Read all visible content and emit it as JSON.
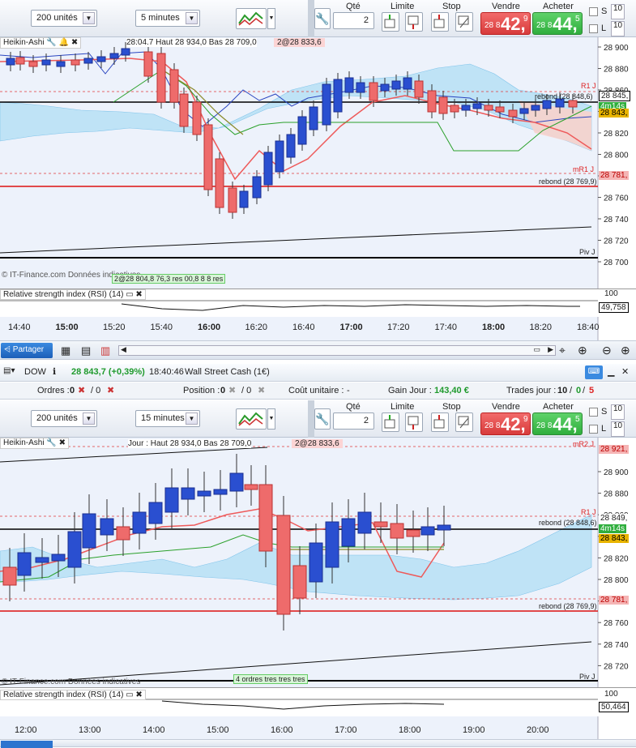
{
  "top": {
    "quantity": "200 unités",
    "interval": "5 minutes",
    "qte_label": "Qté",
    "qte_value": "2",
    "limite_label": "Limite",
    "stop_label": "Stop",
    "vendre_label": "Vendre",
    "acheter_label": "Acheter",
    "bid_small": "28 8",
    "bid_big": "42,",
    "bid_tiny": "9",
    "ask_small": "28 8",
    "ask_big": "44,",
    "ask_tiny": "5",
    "s_label": "S",
    "l_label": "L",
    "s_value": "10",
    "l_value": "10",
    "chart_title": "Heikin-Ashi",
    "legend": "28:04.7 Haut 28 934,0 Bas 28 709,0",
    "legend2": "2@28 833,6",
    "order_legend": "2@28 804,8 76,3 res 00,8 8 8 res",
    "copyright": "© IT-Finance.com  Données indicatives",
    "rsi_label": "Relative strength index (RSI) (14)",
    "rsi_value": "49,758",
    "rsi_top": "100",
    "price_ticks": [
      "28 900",
      "28 880",
      "28 860",
      "28 840",
      "28 820",
      "28 800",
      "28 780",
      "28 760",
      "28 740",
      "28 720",
      "28 700"
    ],
    "badges": {
      "r1": "R1 J",
      "last": "28 845,",
      "timer": "4m14s",
      "cur": "28 843,",
      "mr1": "mR1 J",
      "mr1v": "28 781,",
      "piv": "Piv J"
    },
    "rebond1": "rebond (28 848,6)",
    "rebond2": "rebond (28 769,9)",
    "time_ticks": [
      "14:40",
      "15:00",
      "15:20",
      "15:40",
      "16:00",
      "16:20",
      "16:40",
      "17:00",
      "17:20",
      "17:40",
      "18:00",
      "18:20",
      "18:40"
    ]
  },
  "mid": {
    "share": "Partager",
    "symbol": "DOW",
    "price": "28 843,7 (+0,39%)",
    "time": "18:40:46",
    "name": "Wall Street Cash (1€)",
    "orders_label": "Ordres :",
    "orders": "0",
    "orders2": "/ 0",
    "position_label": "Position :",
    "position": "0",
    "position2": "/ 0",
    "cout_label": "Coût unitaire :",
    "cout": "-",
    "gain_label": "Gain Jour :",
    "gain": "143,40 €",
    "trades_label": "Trades jour :",
    "trades_a": "10",
    "trades_b": "0",
    "trades_c": "5"
  },
  "bottom": {
    "quantity": "200 unités",
    "interval": "15 minutes",
    "qte_label": "Qté",
    "qte_value": "2",
    "limite_label": "Limite",
    "stop_label": "Stop",
    "vendre_label": "Vendre",
    "acheter_label": "Acheter",
    "bid_small": "28 8",
    "bid_big": "42,",
    "bid_tiny": "9",
    "ask_small": "28 8",
    "ask_big": "44,",
    "ask_tiny": "5",
    "s_label": "S",
    "l_label": "L",
    "s_value": "10",
    "l_value": "10",
    "chart_title": "Heikin-Ashi",
    "legend": "Jour : Haut 28 934,0 Bas 28 709,0",
    "legend2": "2@28 833,6",
    "order_legend": "4 ordres tres tres tres",
    "copyright": "© IT-Finance.com  Données indicatives",
    "rsi_label": "Relative strength index (RSI) (14)",
    "rsi_value": "50,464",
    "rsi_top": "100",
    "price_ticks": [
      "28 900",
      "28 880",
      "28 860",
      "28 840",
      "28 820",
      "28 800",
      "28 780",
      "28 760",
      "28 740",
      "28 720"
    ],
    "badges": {
      "mr2": "mR2 J",
      "mr2v": "28 921,",
      "r1": "R1 J",
      "last": "28 849,",
      "timer": "4m14s",
      "cur": "28 843,",
      "mr1v": "28 781,",
      "piv": "Piv J"
    },
    "rebond1": "rebond (28 848,6)",
    "rebond2": "rebond (28 769,9)",
    "time_ticks": [
      "12:00",
      "13:00",
      "14:00",
      "15:00",
      "16:00",
      "17:00",
      "18:00",
      "19:00",
      "20:00"
    ]
  }
}
